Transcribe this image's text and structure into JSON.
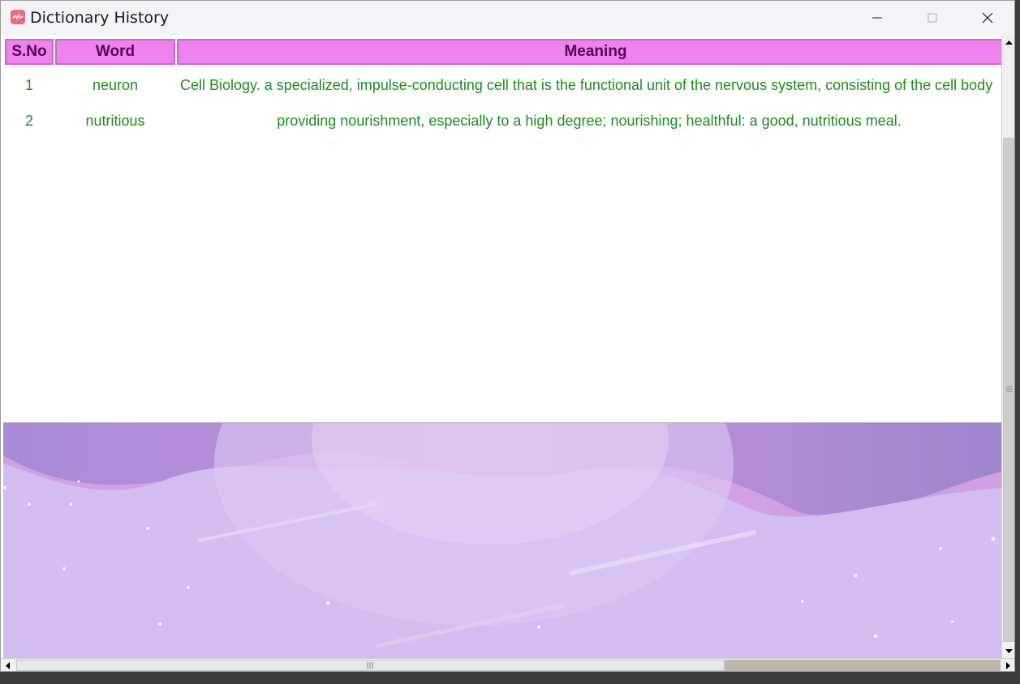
{
  "window": {
    "title": "Dictionary History",
    "icon": "dictionary-app-icon"
  },
  "controls": {
    "minimize": "minimize-icon",
    "maximize": "maximize-icon",
    "close": "close-icon"
  },
  "table": {
    "headers": {
      "sno": "S.No",
      "word": "Word",
      "meaning": "Meaning"
    },
    "rows": [
      {
        "sno": "1",
        "word": "neuron",
        "meaning": "Cell Biology. a specialized, impulse-conducting cell that is the functional unit of the nervous system, consisting of the cell body"
      },
      {
        "sno": "2",
        "word": "nutritious",
        "meaning": "providing nourishment, especially to a high degree; nourishing; healthful: a good, nutritious meal."
      }
    ]
  },
  "colors": {
    "header_bg": "#ee82ee",
    "header_text": "#5a005a",
    "row_text": "#1e8c1e",
    "background_art": "#d2bdf0"
  }
}
